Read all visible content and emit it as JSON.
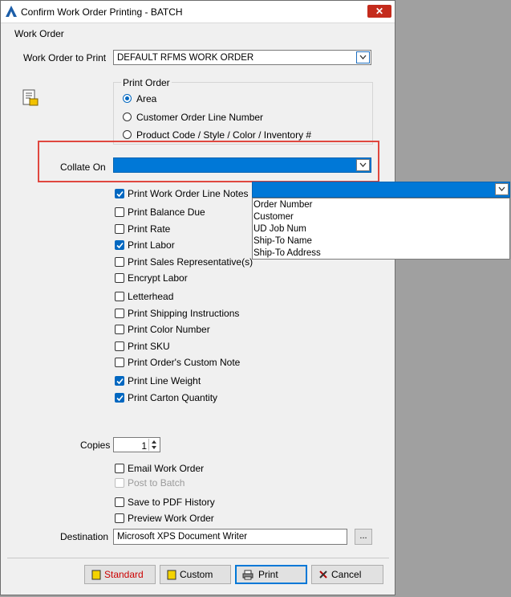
{
  "window": {
    "title": "Confirm Work Order Printing - BATCH",
    "close_glyph": "✕"
  },
  "group": {
    "label": "Work Order"
  },
  "work_order_to_print": {
    "label": "Work Order to Print",
    "value": "DEFAULT RFMS WORK ORDER"
  },
  "print_order": {
    "legend": "Print Order",
    "options": [
      {
        "label": "Area",
        "selected": true
      },
      {
        "label": "Customer Order Line Number",
        "selected": false
      },
      {
        "label": "Product Code / Style / Color / Inventory #",
        "selected": false
      }
    ]
  },
  "collate_on": {
    "label": "Collate On",
    "value": ""
  },
  "collate_dropdown": {
    "value": "",
    "options": [
      "Order Number",
      "Customer",
      "UD Job Num",
      "Ship-To Name",
      "Ship-To Address"
    ]
  },
  "checkboxes": [
    {
      "label": "Print Work Order Line Notes",
      "checked": true
    },
    {
      "label": "Print Balance Due",
      "checked": false
    },
    {
      "label": "Print Rate",
      "checked": false
    },
    {
      "label": "Print Labor",
      "checked": true
    },
    {
      "label": "Print Sales Representative(s)",
      "checked": false
    },
    {
      "label": "Encrypt Labor",
      "checked": false
    },
    {
      "label": "Letterhead",
      "checked": false
    },
    {
      "label": "Print Shipping Instructions",
      "checked": false
    },
    {
      "label": "Print Color Number",
      "checked": false
    },
    {
      "label": "Print SKU",
      "checked": false
    },
    {
      "label": "Print Order's Custom Note",
      "checked": false
    },
    {
      "label": "Print Line Weight",
      "checked": true
    },
    {
      "label": "Print Carton Quantity",
      "checked": true
    }
  ],
  "copies": {
    "label": "Copies",
    "value": "1"
  },
  "email_work_order": {
    "label": "Email Work Order",
    "checked": false
  },
  "post_to_batch": {
    "label": "Post to Batch",
    "checked": false,
    "disabled": true
  },
  "save_to_pdf": {
    "label": "Save to PDF History",
    "checked": false
  },
  "preview_work_order": {
    "label": "Preview Work Order",
    "checked": false
  },
  "destination": {
    "label": "Destination",
    "value": "Microsoft XPS Document Writer",
    "browse_label": "..."
  },
  "buttons": {
    "standard": "Standard",
    "custom": "Custom",
    "print": "Print",
    "cancel": "Cancel"
  },
  "colors": {
    "accent": "#0078d7",
    "highlight_border": "#e0473f",
    "close_red": "#c42b1c"
  }
}
